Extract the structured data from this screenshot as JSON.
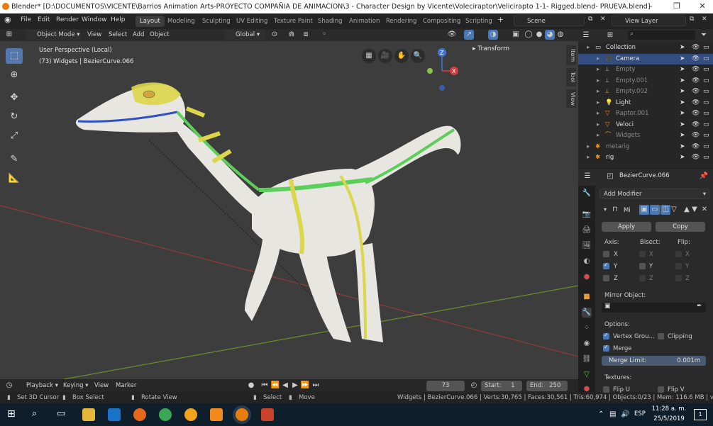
{
  "window": {
    "title": "Blender* [D:\\DOCUMENTOS\\VICENTE\\Barrios Animation Arts-PROYECTO COMPAÑIA DE ANIMACION\\3 - Character Design by Vicente\\Voleciraptor\\Velicirapto 1-1- Rigged.blend- PRUEVA.blend]",
    "minimize": "–",
    "maximize": "❐",
    "close": "✕"
  },
  "menus": [
    "File",
    "Edit",
    "Render",
    "Window",
    "Help"
  ],
  "workspaces": [
    "Layout",
    "Modeling",
    "Sculpting",
    "UV Editing",
    "Texture Paint",
    "Shading",
    "Animation",
    "Rendering",
    "Compositing",
    "Scripting"
  ],
  "active_workspace": "Layout",
  "scene": "Scene",
  "view_layer": "View Layer",
  "viewport_header": {
    "mode": "Object Mode",
    "view": "View",
    "select": "Select",
    "add": "Add",
    "object": "Object",
    "orientation": "Global"
  },
  "viewport": {
    "perspective": "User Perspective (Local)",
    "context": "(73) Widgets | BezierCurve.066",
    "transform_panel": "Transform",
    "side_tabs": [
      "Item",
      "Tool",
      "View"
    ],
    "gizmo_axes": [
      "Z",
      "X",
      "Y"
    ]
  },
  "outliner": {
    "rows": [
      {
        "name": "Collection",
        "type": "collection"
      },
      {
        "name": "Camera",
        "type": "camera"
      },
      {
        "name": "Empty",
        "type": "empty"
      },
      {
        "name": "Empty.001",
        "type": "empty"
      },
      {
        "name": "Empty.002",
        "type": "empty"
      },
      {
        "name": "Light",
        "type": "light"
      },
      {
        "name": "Raptor.001",
        "type": "mesh"
      },
      {
        "name": "Veloci",
        "type": "mesh"
      },
      {
        "name": "Widgets",
        "type": "curve"
      },
      {
        "name": "metarig",
        "type": "armature"
      },
      {
        "name": "rig",
        "type": "armature"
      }
    ]
  },
  "properties": {
    "object": "BezierCurve.066",
    "add_modifier": "Add Modifier",
    "modifier_name": "Mi",
    "apply": "Apply",
    "copy": "Copy",
    "axis_label": "Axis:",
    "bisect_label": "Bisect:",
    "flip_label": "Flip:",
    "axes": [
      "X",
      "Y",
      "Z"
    ],
    "mirror_object": "Mirror Object:",
    "options_label": "Options:",
    "vertex_groups": "Vertex Grou...",
    "clipping": "Clipping",
    "merge": "Merge",
    "merge_limit_label": "Merge Limit:",
    "merge_limit_value": "0.001m",
    "textures": "Textures:",
    "flip_u": "Flip U",
    "flip_v": "Flip V"
  },
  "timeline": {
    "playback": "Playback",
    "keying": "Keying",
    "view": "View",
    "marker": "Marker",
    "current_frame": "73",
    "start_label": "Start:",
    "start": "1",
    "end_label": "End:",
    "end": "250"
  },
  "statusbar": {
    "set_cursor": "Set 3D Cursor",
    "box_select": "Box Select",
    "rotate_view": "Rotate View",
    "select": "Select",
    "move": "Move",
    "stats": "Widgets | BezierCurve.066 | Verts:30,765 | Faces:30,561 | Tris:60,974 | Objects:0/23 | Mem: 116.6 MB | v2.80.68"
  },
  "taskbar": {
    "lang": "ESP",
    "time": "11:28 a. m.",
    "date": "25/5/2019",
    "notifications": "1"
  },
  "colors": {
    "viewport_bg": "#3d3d3d",
    "accent_blue": "#4a78b5",
    "grid_red": "#8f3a3a",
    "grid_green": "#6d8b2f",
    "body": "#e8e6e1",
    "stripe_yellow": "#dcd64a",
    "stripe_green": "#5ccf5a"
  }
}
